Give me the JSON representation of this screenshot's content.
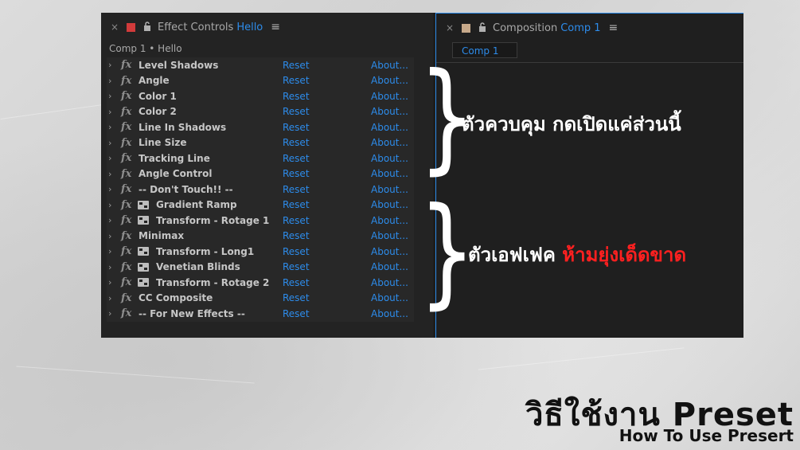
{
  "effect_controls": {
    "close_glyph": "×",
    "swatch_color": "#d23b3b",
    "lock_glyph": "🔓",
    "title": "Effect Controls",
    "title_accent": "Hello",
    "menu_glyph": "≡",
    "subheader": "Comp 1 • Hello",
    "chevron_glyph": "›",
    "fx_glyph": "fx",
    "reset_label": "Reset",
    "about_label": "About...",
    "effects": [
      {
        "name": "Level Shadows",
        "badge": false
      },
      {
        "name": "Angle",
        "badge": false
      },
      {
        "name": "Color 1",
        "badge": false
      },
      {
        "name": "Color 2",
        "badge": false
      },
      {
        "name": "Line In Shadows",
        "badge": false
      },
      {
        "name": "Line Size",
        "badge": false
      },
      {
        "name": "Tracking Line",
        "badge": false
      },
      {
        "name": "Angle Control",
        "badge": false
      },
      {
        "name": "-- Don't Touch!! --",
        "badge": false
      },
      {
        "name": "Gradient Ramp",
        "badge": true
      },
      {
        "name": "Transform - Rotage 1",
        "badge": true
      },
      {
        "name": "Minimax",
        "badge": false
      },
      {
        "name": "Transform - Long1",
        "badge": true
      },
      {
        "name": "Venetian Blinds",
        "badge": true
      },
      {
        "name": "Transform - Rotage 2",
        "badge": true
      },
      {
        "name": "CC Composite",
        "badge": false
      },
      {
        "name": "-- For New Effects --",
        "badge": false
      }
    ]
  },
  "composition": {
    "close_glyph": "×",
    "swatch_color": "#c7a98a",
    "lock_glyph": "🔓",
    "title": "Composition",
    "title_accent": "Comp 1",
    "menu_glyph": "≡",
    "subtab": "Comp 1"
  },
  "annotations": {
    "brace_glyph": "}",
    "controls_note": "ตัวควบคุม กดเปิดแค่ส่วนนี้",
    "effects_note_prefix": "ตัวเอฟเฟค",
    "effects_note_warning": "ห้ามยุ่งเด็ดขาด"
  },
  "title": {
    "main": "วิธีใช้งาน Preset",
    "sub": "How To Use Presert"
  },
  "colors": {
    "accent_blue": "#2d8ceb",
    "warning_red": "#ff2020"
  }
}
